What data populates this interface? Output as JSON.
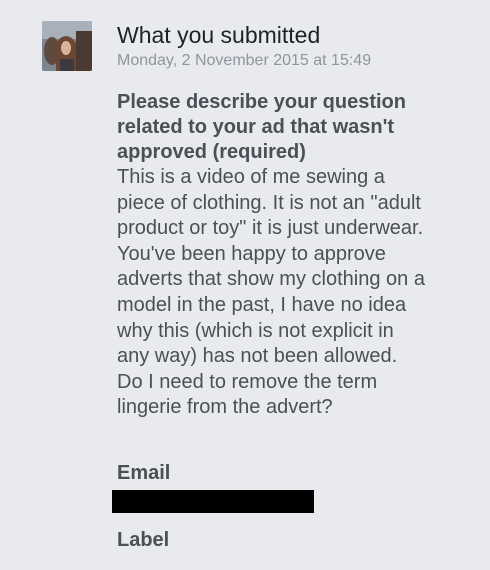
{
  "submission": {
    "title": "What you submitted",
    "timestamp": "Monday, 2 November 2015 at 15:49"
  },
  "question": {
    "label_lines": [
      "Please describe your question",
      "related to your ad that wasn't",
      "approved (required)"
    ],
    "body_lines": [
      "This is a video of me sewing a",
      "piece of clothing. It is not an \"adult",
      "product or toy\" it is just underwear.",
      "You've been happy to approve",
      "adverts that show my clothing on a",
      "model in the past, I have no idea",
      "why this (which is not explicit in",
      "any way) has not been allowed.",
      "Do I need to remove the term",
      "lingerie from the advert?"
    ]
  },
  "email": {
    "label": "Email"
  },
  "label_field": {
    "label": "Label"
  }
}
